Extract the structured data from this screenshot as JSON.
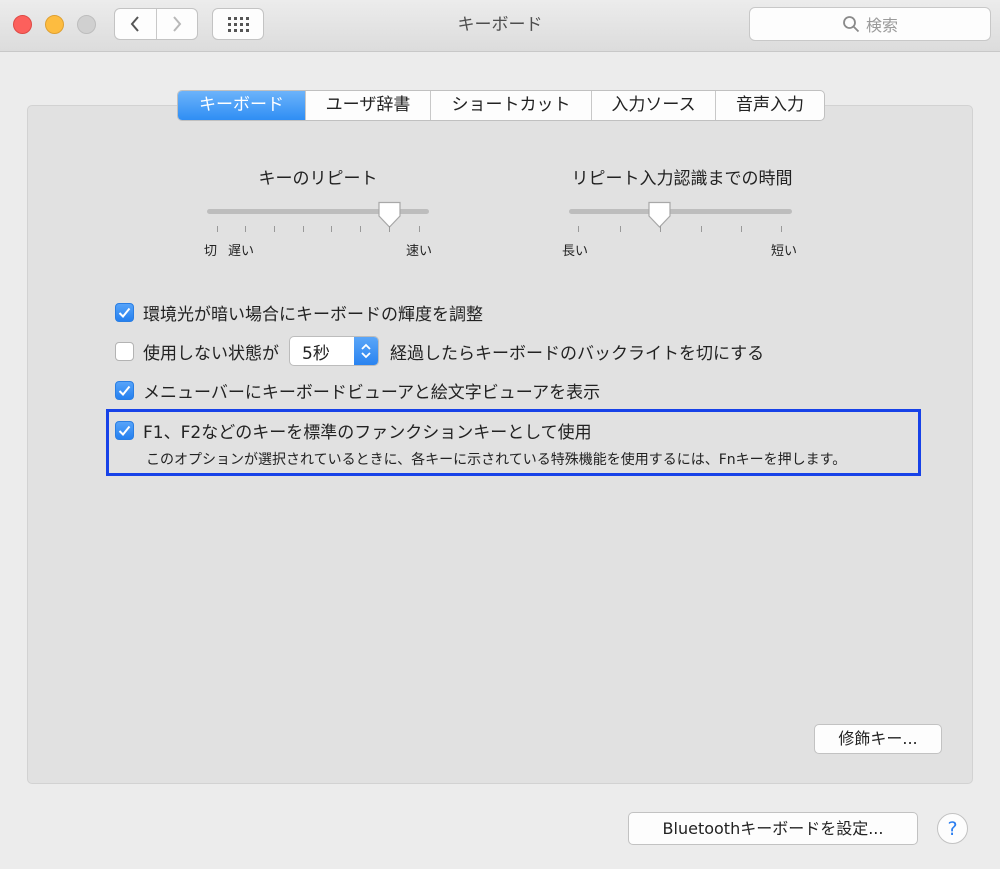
{
  "window": {
    "title": "キーボード"
  },
  "search": {
    "placeholder": "検索"
  },
  "tabs": [
    {
      "label": "キーボード",
      "active": true
    },
    {
      "label": "ユーザ辞書",
      "active": false
    },
    {
      "label": "ショートカット",
      "active": false
    },
    {
      "label": "入力ソース",
      "active": false
    },
    {
      "label": "音声入力",
      "active": false
    }
  ],
  "key_repeat": {
    "title": "キーのリピート",
    "label_off": "切",
    "label_slow": "遅い",
    "label_fast": "速い",
    "level": 0.8
  },
  "repeat_delay": {
    "title": "リピート入力認識までの時間",
    "label_long": "長い",
    "label_short": "短い",
    "level": 0.4
  },
  "options": {
    "adjust_brightness": {
      "label": "環境光が暗い場合にキーボードの輝度を調整",
      "checked": true
    },
    "backlight_off": {
      "label_prefix": "使用しない状態が",
      "stepper_value": "5秒",
      "label_suffix": "経過したらキーボードのバックライトを切にする",
      "checked": false
    },
    "show_viewer": {
      "label": "メニューバーにキーボードビューアと絵文字ビューアを表示",
      "checked": true
    },
    "fn_keys": {
      "label": "F1、F2などのキーを標準のファンクションキーとして使用",
      "description": "このオプションが選択されているときに、各キーに示されている特殊機能を使用するには、Fnキーを押します。",
      "checked": true
    }
  },
  "buttons": {
    "modifier_keys": "修飾キー...",
    "bluetooth_setup": "Bluetoothキーボードを設定...",
    "help": "?"
  },
  "colors": {
    "accent": "#2f8ef4",
    "highlight_border": "#1742e8"
  }
}
